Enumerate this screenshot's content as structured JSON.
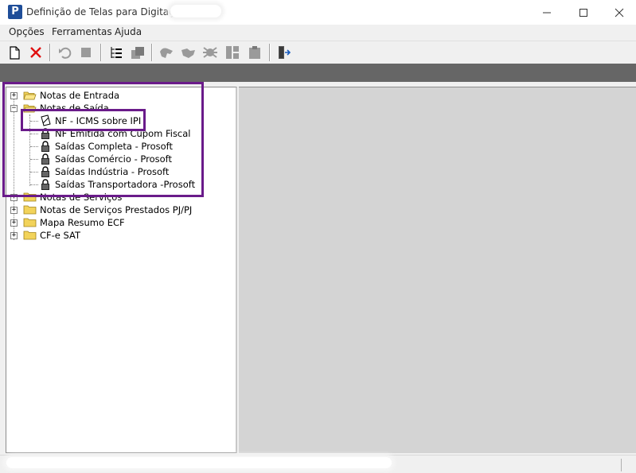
{
  "window": {
    "title": "Definição de Telas para Digitação",
    "app_icon_letter": "P"
  },
  "menu": [
    {
      "label": "Opções"
    },
    {
      "label": "Ferramentas"
    },
    {
      "label": "Ajuda"
    }
  ],
  "tree": {
    "nodes": [
      {
        "label": "Notas de Entrada",
        "expander": "+"
      },
      {
        "label": "Notas de Saída",
        "expander": "−"
      },
      {
        "label": "NF - ICMS sobre IPI"
      },
      {
        "label": "NF Emitida com Cupom Fiscal"
      },
      {
        "label": "Saídas Completa - Prosoft"
      },
      {
        "label": "Saídas Comércio - Prosoft"
      },
      {
        "label": "Saídas Indústria - Prosoft"
      },
      {
        "label": "Saídas Transportadora -Prosoft"
      },
      {
        "label": "Notas de Serviços",
        "expander": "+"
      },
      {
        "label": "Notas de Serviços Prestados PJ/PJ",
        "expander": "+"
      },
      {
        "label": "Mapa Resumo ECF",
        "expander": "+"
      },
      {
        "label": "CF-e SAT",
        "expander": "+"
      }
    ]
  },
  "colors": {
    "highlight": "#6a1b8a",
    "band": "#666666",
    "right_panel": "#d4d4d4"
  }
}
